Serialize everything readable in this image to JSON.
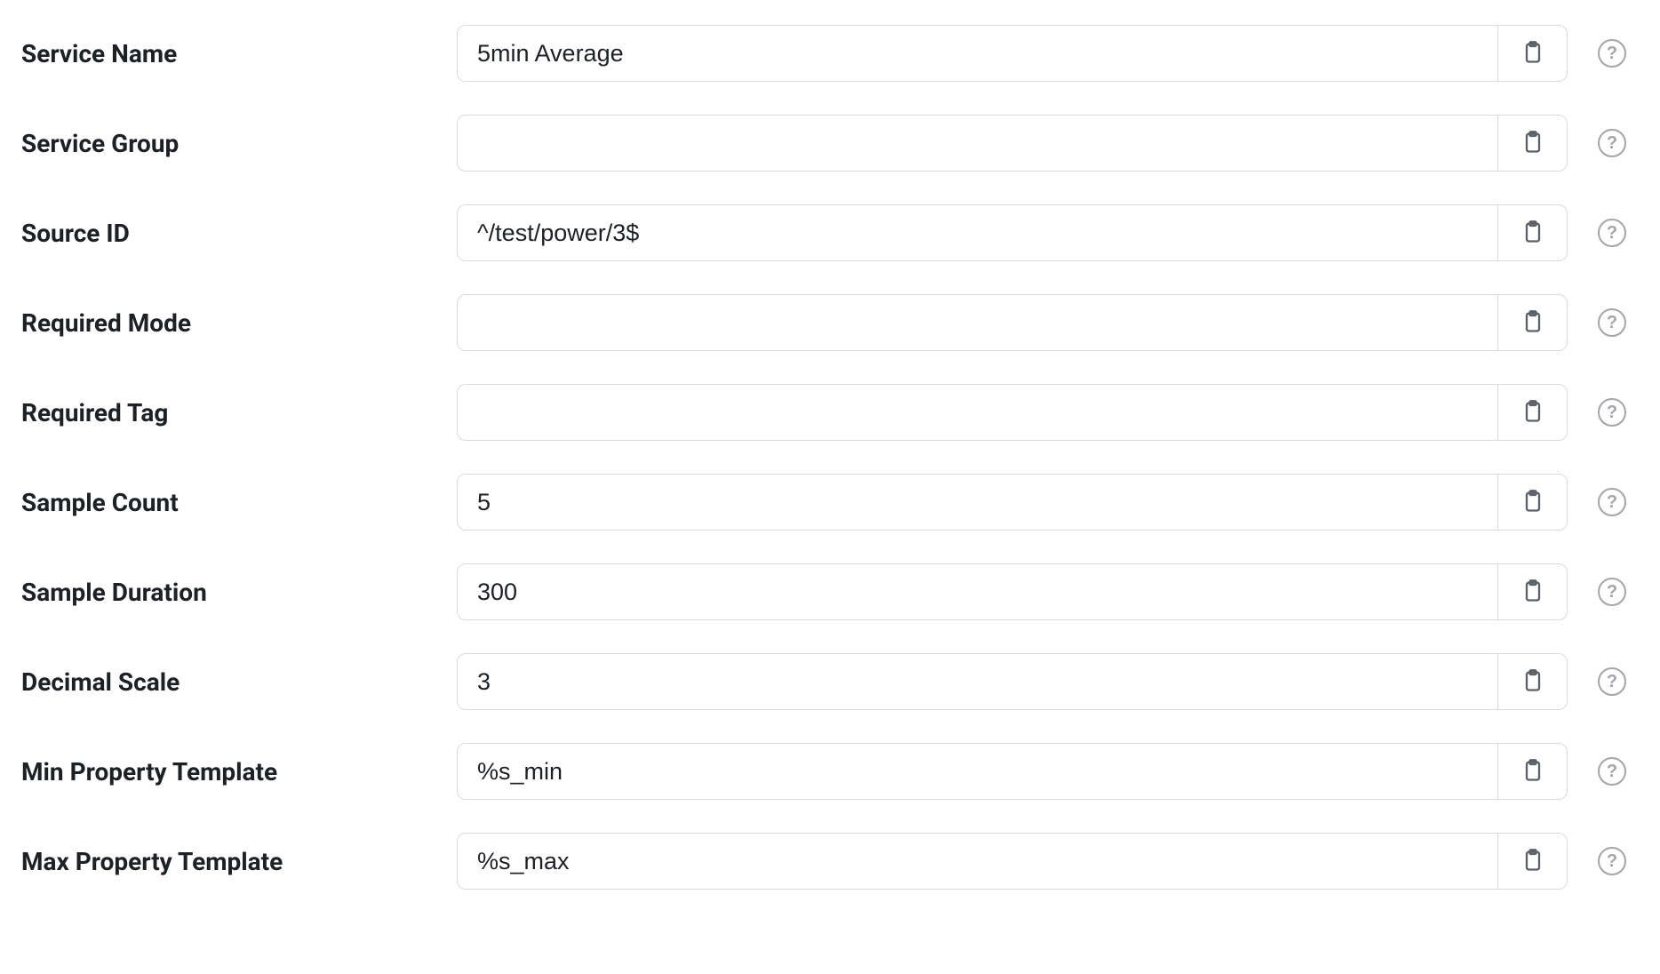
{
  "fields": [
    {
      "key": "service-name",
      "label": "Service Name",
      "value": "5min Average"
    },
    {
      "key": "service-group",
      "label": "Service Group",
      "value": ""
    },
    {
      "key": "source-id",
      "label": "Source ID",
      "value": "^/test/power/3$"
    },
    {
      "key": "required-mode",
      "label": "Required Mode",
      "value": ""
    },
    {
      "key": "required-tag",
      "label": "Required Tag",
      "value": ""
    },
    {
      "key": "sample-count",
      "label": "Sample Count",
      "value": "5"
    },
    {
      "key": "sample-duration",
      "label": "Sample Duration",
      "value": "300"
    },
    {
      "key": "decimal-scale",
      "label": "Decimal Scale",
      "value": "3"
    },
    {
      "key": "min-property-template",
      "label": "Min Property Template",
      "value": "%s_min"
    },
    {
      "key": "max-property-template",
      "label": "Max Property Template",
      "value": "%s_max"
    }
  ]
}
